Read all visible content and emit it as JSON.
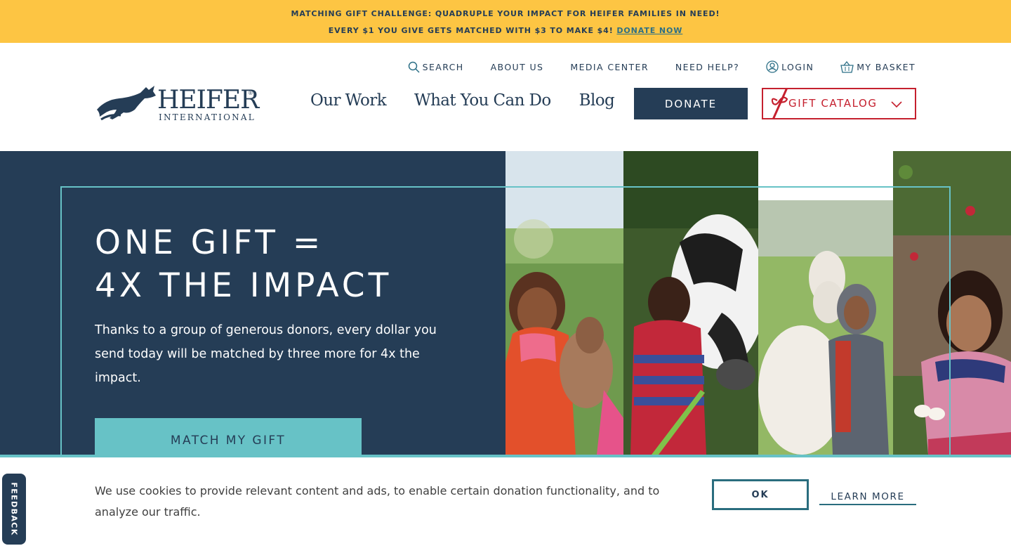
{
  "banner": {
    "line1": "MATCHING GIFT CHALLENGE: QUADRUPLE YOUR IMPACT FOR HEIFER FAMILIES IN NEED!",
    "line2": "EVERY $1 YOU GIVE GETS MATCHED WITH $3 TO MAKE $4!",
    "link": "DONATE NOW"
  },
  "utility_nav": {
    "search": "SEARCH",
    "about": "ABOUT US",
    "media": "MEDIA CENTER",
    "help": "NEED HELP?",
    "login": "LOGIN",
    "basket": "MY BASKET"
  },
  "logo": {
    "word": "HEIFER",
    "sub": "INTERNATIONAL",
    "reg": "®"
  },
  "main_nav": {
    "items": [
      {
        "label": "Our Work"
      },
      {
        "label": "What You Can Do"
      },
      {
        "label": "Blog"
      }
    ],
    "donate": "DONATE",
    "gift_catalog": "GIFT CATALOG"
  },
  "hero": {
    "title": "ONE GIFT =\n4X THE IMPACT",
    "body": "Thanks to a group of generous donors, every dollar you send today will be matched by three more for 4x the impact.",
    "cta": "MATCH MY GIFT"
  },
  "cookie": {
    "text": "We use cookies to provide relevant content and ads, to enable certain donation functionality, and to analyze our traffic.",
    "ok": "OK",
    "learn_more": "LEARN MORE"
  },
  "feedback": "FEEDBACK",
  "colors": {
    "navy": "#253d56",
    "teal": "#67c2c6",
    "banner_yellow": "#fdc543",
    "red": "#c5202e"
  }
}
